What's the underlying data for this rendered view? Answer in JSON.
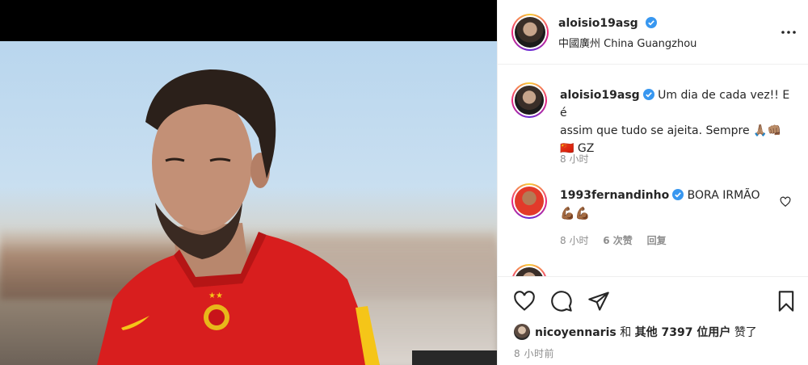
{
  "post": {
    "username": "aloisio19asg",
    "location": "中國廣州 China Guangzhou"
  },
  "caption": {
    "username": "aloisio19asg",
    "text_line1": "Um dia de cada vez!! E é",
    "text_line2": "assim que tudo se ajeita. Sempre 🙏🏽👊🏽",
    "text_line3": "🇨🇳 GZ",
    "time": "8 小时"
  },
  "comments": [
    {
      "username": "1993fernandinho",
      "text": "BORA IRMÃO",
      "emoji": "💪🏾💪🏾",
      "time": "8 小时",
      "likes": "6 次赞",
      "reply": "回复"
    }
  ],
  "likes": {
    "first_user": "nicoyennaris",
    "connector": "和",
    "others": "其他 7397 位用户",
    "suffix": "赞了"
  },
  "timestamp": "8 小时前",
  "icons": {
    "more": "more-horizontal-icon",
    "like": "heart-icon",
    "comment": "comment-icon",
    "share": "paper-plane-icon",
    "save": "bookmark-icon",
    "verified": "verified-badge-icon"
  },
  "colors": {
    "verified": "#3897f0",
    "jersey_red": "#d81e1e",
    "muted": "#8e8e8e"
  }
}
